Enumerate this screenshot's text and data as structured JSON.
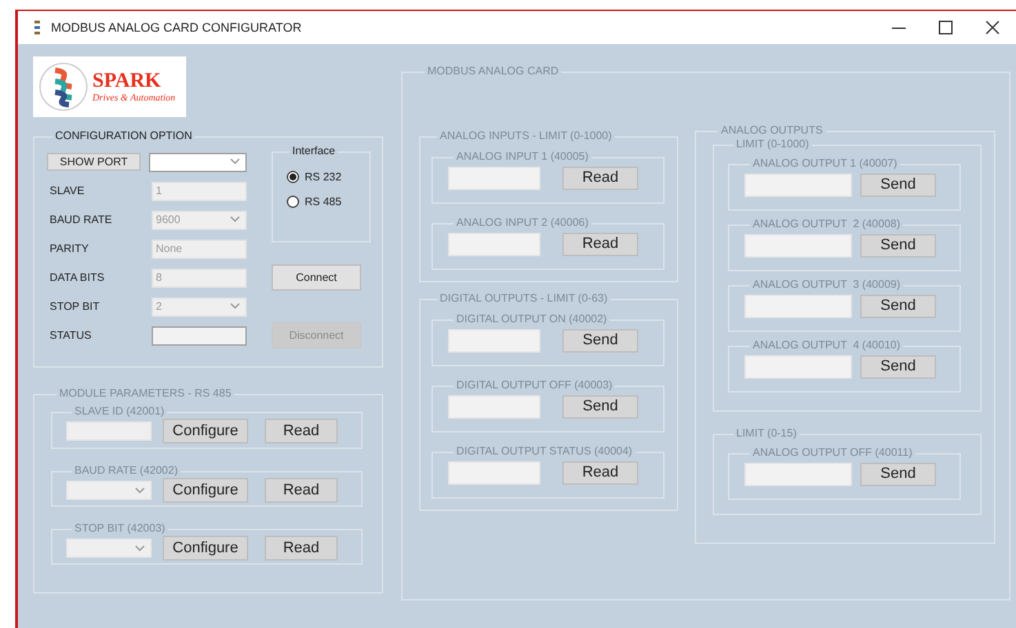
{
  "window": {
    "title": "MODBUS ANALOG CARD CONFIGURATOR"
  },
  "logo": {
    "name": "SPARK",
    "tagline": "Drives & Automation"
  },
  "configuration": {
    "title": "CONFIGURATION OPTION",
    "show_port_button": "SHOW PORT",
    "port": {
      "kind": "select",
      "disabled": false
    },
    "fields": [
      {
        "label": "SLAVE",
        "kind": "text",
        "value": "1",
        "disabled": true
      },
      {
        "label": "BAUD RATE",
        "kind": "select",
        "value": "9600",
        "disabled": true
      },
      {
        "label": "PARITY",
        "kind": "text",
        "value": "None",
        "disabled": true
      },
      {
        "label": "DATA BITS",
        "kind": "text",
        "value": "8",
        "disabled": true
      },
      {
        "label": "STOP BIT",
        "kind": "select",
        "value": "2",
        "disabled": true
      },
      {
        "label": "STATUS",
        "kind": "text",
        "disabled": false
      }
    ],
    "interface": {
      "title": "Interface",
      "options": [
        {
          "label": "RS 232",
          "selected": true
        },
        {
          "label": "RS 485",
          "selected": false
        }
      ]
    },
    "buttons": [
      {
        "label": "Connect",
        "disabled": false
      },
      {
        "label": "Disconnect",
        "disabled": true
      }
    ]
  },
  "module_parameters": {
    "title": "MODULE PARAMETERS - RS 485",
    "disabled": true,
    "groups": [
      {
        "title": "SLAVE ID (42001)",
        "kind": "text",
        "buttons": [
          "Configure",
          "Read"
        ]
      },
      {
        "title": "BAUD RATE (42002)",
        "kind": "select",
        "buttons": [
          "Configure",
          "Read"
        ]
      },
      {
        "title": "STOP BIT (42003)",
        "kind": "select",
        "buttons": [
          "Configure",
          "Read"
        ]
      }
    ]
  },
  "modbus_card": {
    "title": "MODBUS ANALOG CARD",
    "disabled": true,
    "analog_inputs": {
      "title": "ANALOG INPUTS - LIMIT (0-1000)",
      "items": [
        {
          "title": "ANALOG INPUT 1 (40005)",
          "button": "Read"
        },
        {
          "title": "ANALOG INPUT 2 (40006)",
          "button": "Read"
        }
      ]
    },
    "digital_outputs": {
      "title": "DIGITAL OUTPUTS - LIMIT (0-63)",
      "items": [
        {
          "title": "DIGITAL OUTPUT ON (40002)",
          "button": "Send"
        },
        {
          "title": "DIGITAL OUTPUT OFF (40003)",
          "button": "Send"
        },
        {
          "title": "DIGITAL OUTPUT STATUS (40004)",
          "button": "Read"
        }
      ]
    },
    "analog_outputs": {
      "title": "ANALOG OUTPUTS",
      "sections": [
        {
          "title": "LIMIT (0-1000)",
          "items": [
            {
              "title": "ANALOG OUTPUT 1 (40007)",
              "button": "Send"
            },
            {
              "title": "ANALOG OUTPUT  2 (40008)",
              "button": "Send"
            },
            {
              "title": "ANALOG OUTPUT  3 (40009)",
              "button": "Send"
            },
            {
              "title": "ANALOG OUTPUT  4 (40010)",
              "button": "Send"
            }
          ]
        },
        {
          "title": "LIMIT (0-15)",
          "items": [
            {
              "title": "ANALOG OUTPUT OFF (40011)",
              "button": "Send"
            }
          ]
        }
      ]
    }
  }
}
